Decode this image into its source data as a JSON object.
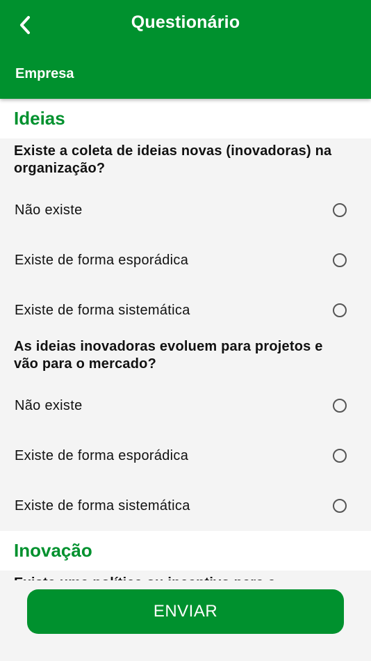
{
  "header": {
    "title": "Questionário",
    "subtitle": "Empresa"
  },
  "sections": [
    {
      "title": "Ideias",
      "questions": [
        {
          "text": "Existe a coleta de ideias novas (inovadoras) na organização?",
          "options": [
            "Não existe",
            "Existe de forma esporádica",
            "Existe de forma sistemática"
          ]
        },
        {
          "text": "As ideias inovadoras evoluem para projetos e vão para o mercado?",
          "options": [
            "Não existe",
            "Existe de forma esporádica",
            "Existe de forma sistemática"
          ]
        }
      ]
    },
    {
      "title": "Inovação",
      "questions": [
        {
          "text": "Existe uma política ou incentivo para a"
        }
      ]
    }
  ],
  "footer": {
    "submit_label": "ENVIAR"
  },
  "colors": {
    "brand": "#00912e",
    "background": "#f4f4f4"
  },
  "icons": {
    "back": "chevron-left-icon",
    "radio": "radio-unchecked-icon"
  }
}
